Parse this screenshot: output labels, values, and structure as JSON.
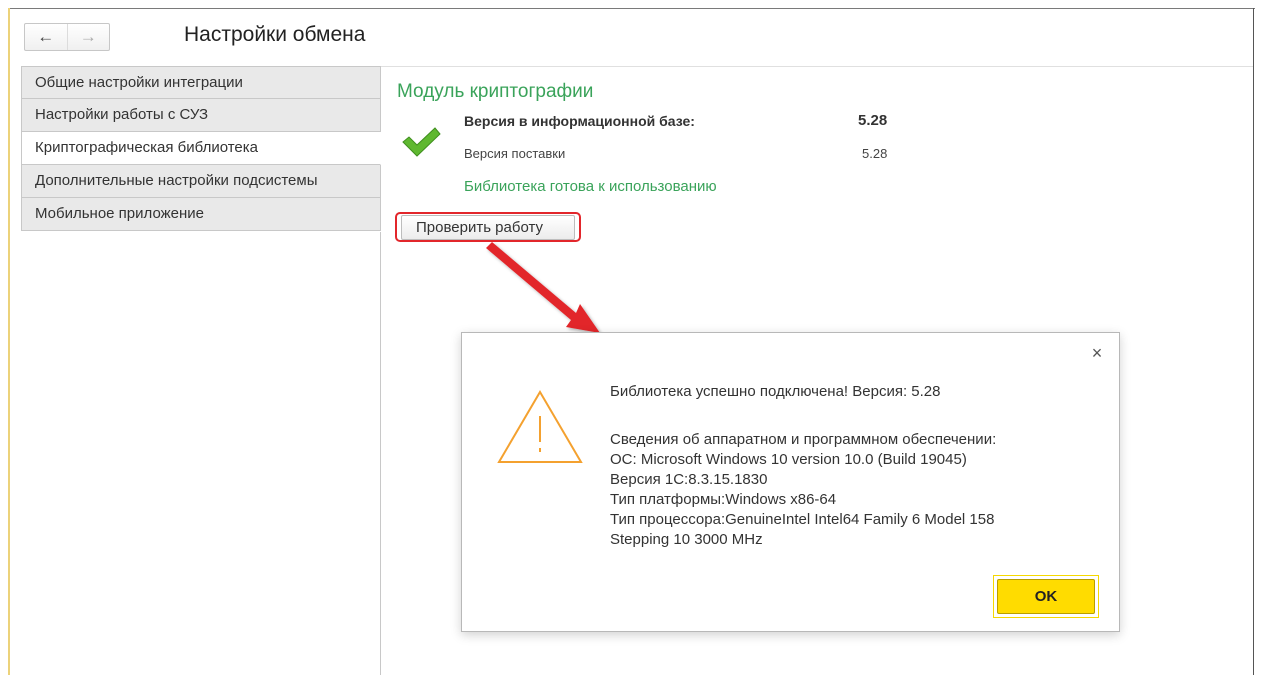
{
  "window": {
    "title": "Настройки обмена",
    "nav_back_icon": "←",
    "nav_forward_icon": "→"
  },
  "sidebar": {
    "items": [
      {
        "label": "Общие настройки интеграции",
        "active": false
      },
      {
        "label": "Настройки работы с СУЗ",
        "active": false
      },
      {
        "label": "Криптографическая библиотека",
        "active": true
      },
      {
        "label": "Дополнительные настройки подсистемы",
        "active": false
      },
      {
        "label": "Мобильное приложение",
        "active": false
      }
    ]
  },
  "main": {
    "section_title": "Модуль криптографии",
    "version_db_label": "Версия в информационной базе:",
    "version_db_value": "5.28",
    "version_supply_label": "Версия поставки",
    "version_supply_value": "5.28",
    "status_text": "Библиотека готова к использованию",
    "check_button_label": "Проверить работу",
    "status_icon": "check-icon"
  },
  "dialog": {
    "close_icon": "×",
    "warning_icon": "warning-icon",
    "message_line": "Библиотека успешно подключена! Версия: 5.28",
    "details": [
      "Сведения об аппаратном и программном обеспечении:",
      "ОС: Microsoft Windows 10 version 10.0  (Build 19045)",
      "Версия 1С:8.3.15.1830",
      "Тип платформы:Windows x86-64",
      "Тип процессора:GenuineIntel Intel64 Family 6 Model 158",
      "Stepping 10 3000 MHz"
    ],
    "ok_label": "OK"
  },
  "colors": {
    "accent_green": "#3aa35a",
    "highlight_red": "#e2262b",
    "ok_yellow": "#ffdc00",
    "warning_orange": "#f4a12f"
  }
}
